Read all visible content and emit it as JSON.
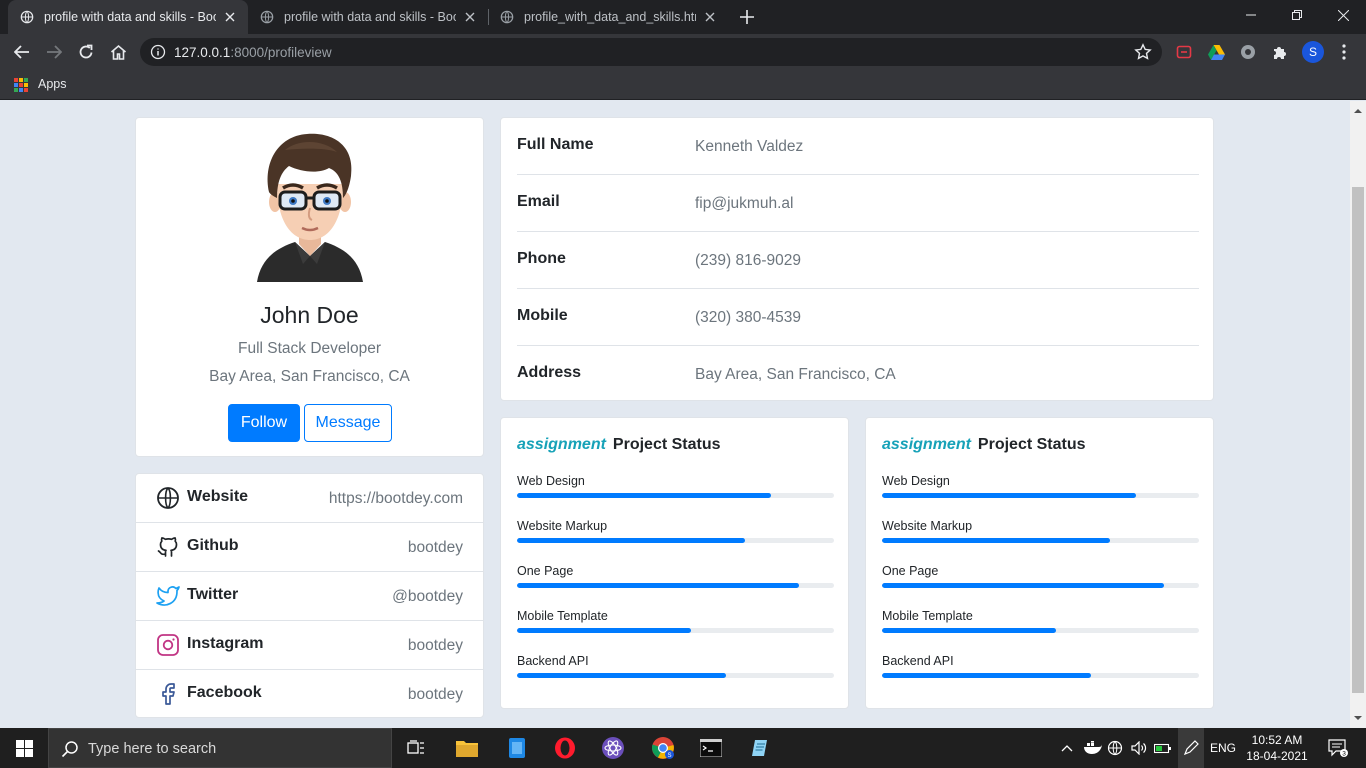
{
  "browser": {
    "tabs": [
      {
        "title": "profile with data and skills - Boot",
        "active": true
      },
      {
        "title": "profile with data and skills - Boot",
        "active": false
      },
      {
        "title": "profile_with_data_and_skills.html",
        "active": false
      }
    ],
    "url_host": "127.0.0.1",
    "url_path": ":8000/profileview",
    "bookmarks": {
      "apps_label": "Apps"
    },
    "avatar_letter": "S",
    "colors": {
      "tabstrip": "#202124",
      "toolbar": "#35363a"
    }
  },
  "profile": {
    "name": "John Doe",
    "role": "Full Stack Developer",
    "location": "Bay Area, San Francisco, CA",
    "follow_label": "Follow",
    "message_label": "Message"
  },
  "social": [
    {
      "label": "Website",
      "value": "https://bootdey.com",
      "icon": "globe-icon"
    },
    {
      "label": "Github",
      "value": "bootdey",
      "icon": "github-icon"
    },
    {
      "label": "Twitter",
      "value": "@bootdey",
      "icon": "twitter-icon"
    },
    {
      "label": "Instagram",
      "value": "bootdey",
      "icon": "instagram-icon"
    },
    {
      "label": "Facebook",
      "value": "bootdey",
      "icon": "facebook-icon"
    }
  ],
  "details": [
    {
      "label": "Full Name",
      "value": "Kenneth Valdez"
    },
    {
      "label": "Email",
      "value": "fip@jukmuh.al"
    },
    {
      "label": "Phone",
      "value": "(239) 816-9029"
    },
    {
      "label": "Mobile",
      "value": "(320) 380-4539"
    },
    {
      "label": "Address",
      "value": "Bay Area, San Francisco, CA"
    }
  ],
  "status_cards": [
    {
      "icon_text": "assignment",
      "title": "Project Status",
      "skills": [
        {
          "label": "Web Design",
          "progress": 0.8
        },
        {
          "label": "Website Markup",
          "progress": 0.72
        },
        {
          "label": "One Page",
          "progress": 0.89
        },
        {
          "label": "Mobile Template",
          "progress": 0.55
        },
        {
          "label": "Backend API",
          "progress": 0.66
        }
      ]
    },
    {
      "icon_text": "assignment",
      "title": "Project Status",
      "skills": [
        {
          "label": "Web Design",
          "progress": 0.8
        },
        {
          "label": "Website Markup",
          "progress": 0.72
        },
        {
          "label": "One Page",
          "progress": 0.89
        },
        {
          "label": "Mobile Template",
          "progress": 0.55
        },
        {
          "label": "Backend API",
          "progress": 0.66
        }
      ]
    }
  ],
  "taskbar": {
    "search_placeholder": "Type here to search",
    "language": "ENG",
    "time": "10:52 AM",
    "date": "18-04-2021",
    "notification_count": "3"
  },
  "theme": {
    "primary": "#007bff",
    "accent": "#17a2b8",
    "page_bg": "#e2e8f0"
  }
}
